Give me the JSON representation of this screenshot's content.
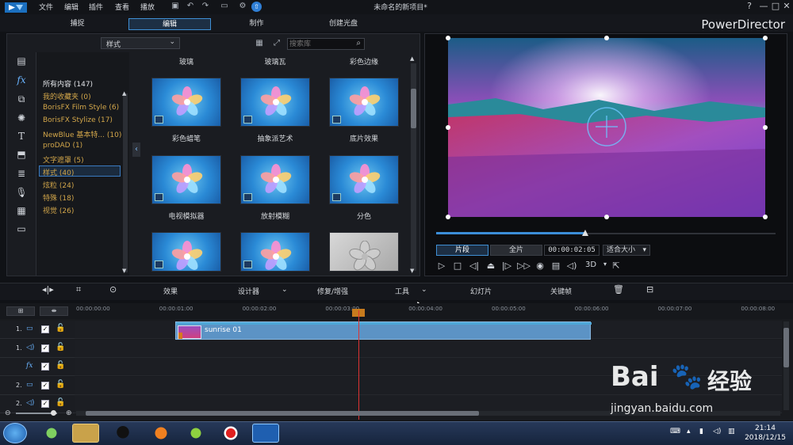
{
  "menubar": {
    "items": [
      "文件",
      "编辑",
      "插件",
      "查看",
      "播放"
    ],
    "document_title": "未命名的新项目*",
    "help": "?",
    "minimize": "—",
    "maximize": "□",
    "close": "✕"
  },
  "modes": {
    "capture": "捕捉",
    "edit": "编辑",
    "produce": "制作",
    "create_disc": "创建光盘",
    "brand": "PowerDirector"
  },
  "library": {
    "category_dropdown": "样式",
    "search_placeholder": "搜索库",
    "categories": [
      {
        "label": "所有内容 (147)",
        "style": "white"
      },
      {
        "label": "我的收藏夹  (0)",
        "style": "gold"
      },
      {
        "label": "BorisFX Film Style  (6)",
        "style": "gold"
      },
      {
        "label": "BorisFX Stylize  (17)",
        "style": "gold"
      },
      {
        "label": "NewBlue 基本特...  (10)",
        "style": "gold"
      },
      {
        "label": "proDAD  (1)",
        "style": "gold"
      },
      {
        "label": "文字遮罩  (5)",
        "style": "gold"
      },
      {
        "label": "样式  (40)",
        "style": "gold"
      },
      {
        "label": "炫粒  (24)",
        "style": "gold"
      },
      {
        "label": "特殊  (18)",
        "style": "gold"
      },
      {
        "label": "视觉  (26)",
        "style": "gold"
      }
    ],
    "header_labels": [
      "玻璃",
      "玻璃瓦",
      "彩色边缘"
    ],
    "effects": [
      {
        "label": "彩色蜡笔",
        "thumb": "blue"
      },
      {
        "label": "抽象派艺术",
        "thumb": "blue"
      },
      {
        "label": "底片效果",
        "thumb": "blue"
      },
      {
        "label": "电视模拟器",
        "thumb": "blue"
      },
      {
        "label": "放射模糊",
        "thumb": "blue"
      },
      {
        "label": "分色",
        "thumb": "blue"
      },
      {
        "label": "",
        "thumb": "blue"
      },
      {
        "label": "",
        "thumb": "blue"
      },
      {
        "label": "",
        "thumb": "gray"
      }
    ]
  },
  "preview": {
    "clip_button": "片段",
    "full_button": "全片",
    "timecode": "00:00:02:05",
    "fit_select": "适合大小",
    "mode_3d": "3D",
    "seek_progress": 0.44
  },
  "edit_toolbar": {
    "effects": "效果",
    "designer": "设计器",
    "repair": "修复/增强",
    "tools": "工具",
    "slideshow": "幻灯片",
    "keyframe": "关键帧"
  },
  "timeline": {
    "ticks": [
      "00:00:00:00",
      "00:00:01:00",
      "00:00:02:00",
      "00:00:03:00",
      "00:00:04:00",
      "00:00:05:00",
      "00:00:06:00",
      "00:00:07:00",
      "00:00:08:00"
    ],
    "tracks": [
      {
        "num": "1.",
        "type": "video-track-icon"
      },
      {
        "num": "1.",
        "type": "audio-track-icon"
      },
      {
        "num": "",
        "type": "fx-track-icon"
      },
      {
        "num": "2.",
        "type": "video-track-icon"
      },
      {
        "num": "2.",
        "type": "audio-track-icon"
      }
    ],
    "clip_name": "sunrise 01"
  },
  "taskbar": {
    "time": "21:14",
    "date": "2018/12/15"
  },
  "watermark": {
    "brand": "Bai",
    "brand2": "经验",
    "url": "jingyan.baidu.com"
  }
}
